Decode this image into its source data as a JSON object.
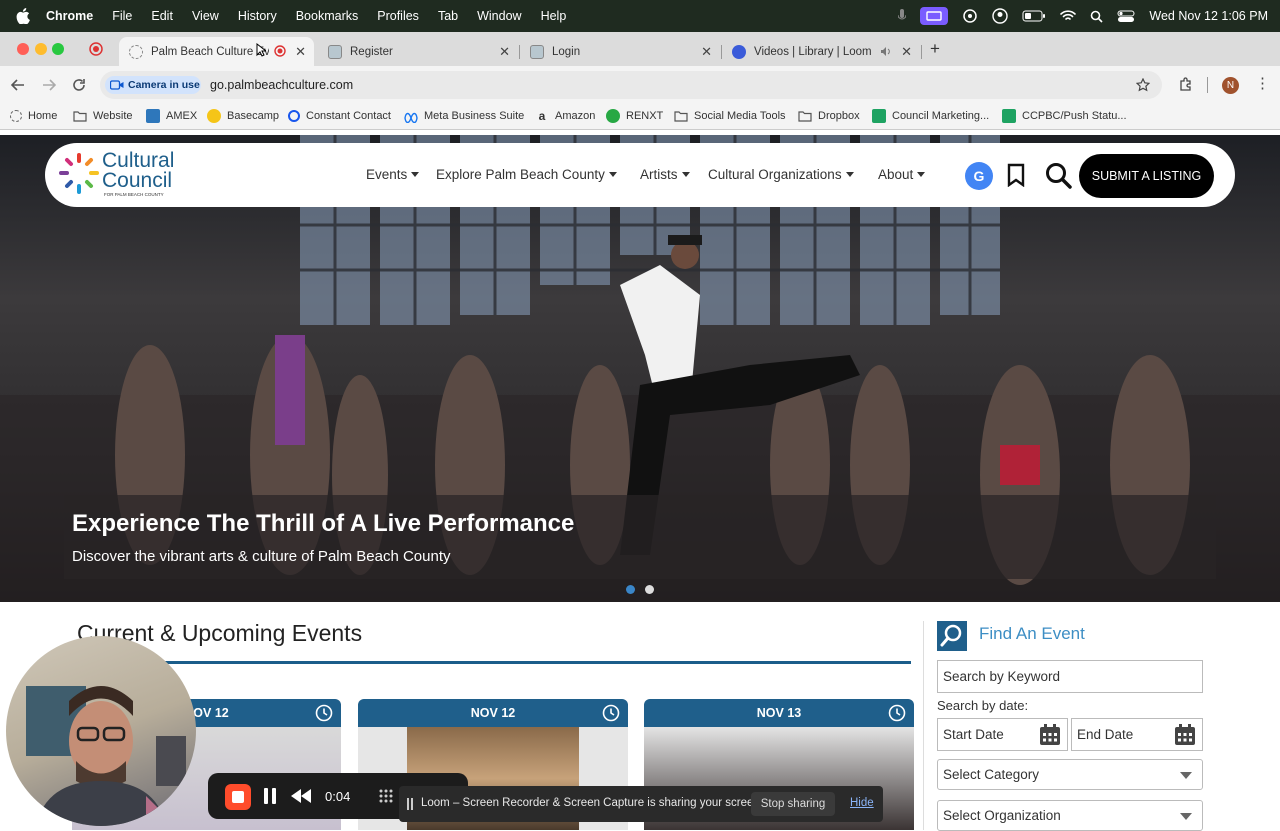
{
  "menubar": {
    "app": "Chrome",
    "items": [
      "File",
      "Edit",
      "View",
      "History",
      "Bookmarks",
      "Profiles",
      "Tab",
      "Window",
      "Help"
    ],
    "datetime": "Wed Nov 12  1:06 PM"
  },
  "tabs": [
    {
      "title": "Palm Beach Culture Eve"
    },
    {
      "title": "Register"
    },
    {
      "title": "Login"
    },
    {
      "title": "Videos | Library | Loom"
    }
  ],
  "toolbar": {
    "camera_pill": "Camera in use",
    "url": "go.palmbeachculture.com",
    "profile_initial": "N"
  },
  "bookmarks": [
    {
      "label": "Home",
      "icon": "home-icon"
    },
    {
      "label": "Website",
      "icon": "folder-icon"
    },
    {
      "label": "AMEX",
      "icon": "amex-icon"
    },
    {
      "label": "Basecamp",
      "icon": "basecamp-icon"
    },
    {
      "label": "Constant Contact",
      "icon": "constant-contact-icon"
    },
    {
      "label": "Meta Business Suite",
      "icon": "meta-icon"
    },
    {
      "label": "Amazon",
      "icon": "amazon-icon"
    },
    {
      "label": "RENXT",
      "icon": "renxt-icon"
    },
    {
      "label": "Social Media Tools",
      "icon": "folder-icon"
    },
    {
      "label": "Dropbox",
      "icon": "folder-icon"
    },
    {
      "label": "Council Marketing...",
      "icon": "sheets-icon"
    },
    {
      "label": "CCPBC/Push Statu...",
      "icon": "sheets-icon"
    }
  ],
  "site": {
    "logo_line1": "Cultural",
    "logo_line2": "Council",
    "logo_tag": "FOR PALM BEACH COUNTY",
    "nav": [
      "Events",
      "Explore Palm Beach County",
      "Artists",
      "Cultural Organizations",
      "About"
    ],
    "submit": "SUBMIT A LISTING"
  },
  "hero": {
    "headline": "Experience The Thrill of A Live Performance",
    "subline": "Discover the vibrant arts & culture of Palm Beach County",
    "slides": 2,
    "active_slide": 1
  },
  "events": {
    "title": "Current & Upcoming Events",
    "cards": [
      {
        "date": "NOV 12"
      },
      {
        "date": "NOV 12"
      },
      {
        "date": "NOV 13"
      }
    ]
  },
  "find": {
    "title": "Find An Event",
    "keyword_placeholder": "Search by Keyword",
    "date_label": "Search by date:",
    "start_placeholder": "Start Date",
    "end_placeholder": "End Date",
    "category": "Select Category",
    "organization": "Select Organization"
  },
  "loom": {
    "timer": "0:04",
    "share_text": "Loom – Screen Recorder & Screen Capture is sharing your screen.",
    "stop_label": "Stop sharing",
    "hide_label": "Hide"
  },
  "colors": {
    "accent_blue": "#1f5f8b",
    "link_blue": "#3d8ec4",
    "loom_red": "#ff4c2b"
  }
}
